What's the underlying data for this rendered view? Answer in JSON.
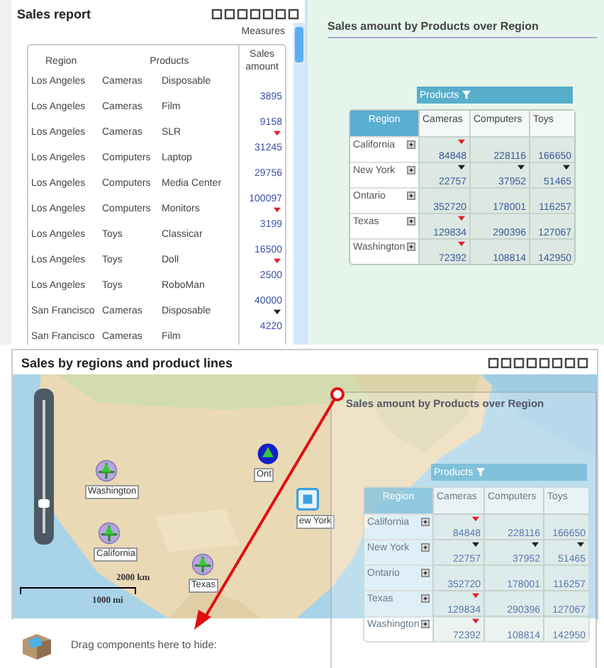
{
  "sales_report": {
    "title": "Sales report",
    "measures_label": "Measures",
    "columns": [
      "Region",
      "Products",
      "Sales amount"
    ],
    "rows": [
      {
        "region": "Los Angeles",
        "category": "Cameras",
        "product": "Disposable",
        "amount": "3895"
      },
      {
        "region": "Los Angeles",
        "category": "Cameras",
        "product": "Film",
        "amount": "9158"
      },
      {
        "region": "Los Angeles",
        "category": "Cameras",
        "product": "SLR",
        "amount": "31245",
        "color": "#e0202a"
      },
      {
        "region": "Los Angeles",
        "category": "Computers",
        "product": "Laptop",
        "amount": "29756"
      },
      {
        "region": "Los Angeles",
        "category": "Computers",
        "product": "Media Center",
        "amount": "100097"
      },
      {
        "region": "Los Angeles",
        "category": "Computers",
        "product": "Monitors",
        "amount": "3199",
        "color": "#e0202a"
      },
      {
        "region": "Los Angeles",
        "category": "Toys",
        "product": "Classicar",
        "amount": "16500"
      },
      {
        "region": "Los Angeles",
        "category": "Toys",
        "product": "Doll",
        "amount": "2500",
        "color": "#e0202a"
      },
      {
        "region": "Los Angeles",
        "category": "Toys",
        "product": "RoboMan",
        "amount": "40000"
      },
      {
        "region": "San Francisco",
        "category": "Cameras",
        "product": "Disposable",
        "amount": "4220",
        "color": "#222222"
      },
      {
        "region": "San Francisco",
        "category": "Cameras",
        "product": "Film"
      }
    ]
  },
  "pivot": {
    "title": "Sales amount by Products over Region",
    "column_header": "Products",
    "row_header": "Region",
    "columns": [
      "Cameras",
      "Computers",
      "Toys"
    ],
    "rows": [
      {
        "region": "California",
        "cells": [
          {
            "value": "84848",
            "color": "#e0202a"
          },
          {
            "value": "228116"
          },
          {
            "value": "166650"
          }
        ]
      },
      {
        "region": "New York",
        "cells": [
          {
            "value": "22757",
            "color": "#222222"
          },
          {
            "value": "37952",
            "color": "#222222"
          },
          {
            "value": "51465",
            "color": "#222222"
          }
        ]
      },
      {
        "region": "Ontario",
        "cells": [
          {
            "value": "352720"
          },
          {
            "value": "178001"
          },
          {
            "value": "116257"
          }
        ]
      },
      {
        "region": "Texas",
        "cells": [
          {
            "value": "129834",
            "color": "#e0202a"
          },
          {
            "value": "290396"
          },
          {
            "value": "127067"
          }
        ]
      },
      {
        "region": "Washington",
        "cells": [
          {
            "value": "72392",
            "color": "#e0202a"
          },
          {
            "value": "108814"
          },
          {
            "value": "142950"
          }
        ]
      }
    ]
  },
  "map_panel": {
    "title": "Sales by regions and product lines",
    "zoom": {
      "level": 0.2
    },
    "markers": [
      {
        "label": "Washington",
        "kind": "pie"
      },
      {
        "label": "California",
        "kind": "pie"
      },
      {
        "label": "Texas",
        "kind": "pie"
      },
      {
        "label": "Ont",
        "kind": "dot"
      },
      {
        "label": "ew York",
        "kind": "widget"
      }
    ],
    "scale": [
      "2000 km",
      "1000 mi"
    ]
  },
  "drag_ghost": {
    "title": "Sales amount by Products over Region",
    "column_header": "Products",
    "row_header": "Region",
    "columns": [
      "Cameras",
      "Computers",
      "Toys"
    ],
    "rows": [
      {
        "region": "California",
        "cells": [
          {
            "value": "84848",
            "color": "#e0202a"
          },
          {
            "value": "228116"
          },
          {
            "value": "166650"
          }
        ]
      },
      {
        "region": "New York",
        "cells": [
          {
            "value": "22757",
            "color": "#222222"
          },
          {
            "value": "37952",
            "color": "#222222"
          },
          {
            "value": "51465",
            "color": "#222222"
          }
        ]
      },
      {
        "region": "Ontario",
        "cells": [
          {
            "value": "352720"
          },
          {
            "value": "178001"
          },
          {
            "value": "116257"
          }
        ]
      },
      {
        "region": "Texas",
        "cells": [
          {
            "value": "129834",
            "color": "#e0202a"
          },
          {
            "value": "290396"
          },
          {
            "value": "127067"
          }
        ]
      },
      {
        "region": "Washington",
        "cells": [
          {
            "value": "72392",
            "color": "#e0202a"
          },
          {
            "value": "108814"
          },
          {
            "value": "142950"
          }
        ]
      }
    ]
  },
  "hide_area": {
    "label": "Drag components here to hide:"
  }
}
